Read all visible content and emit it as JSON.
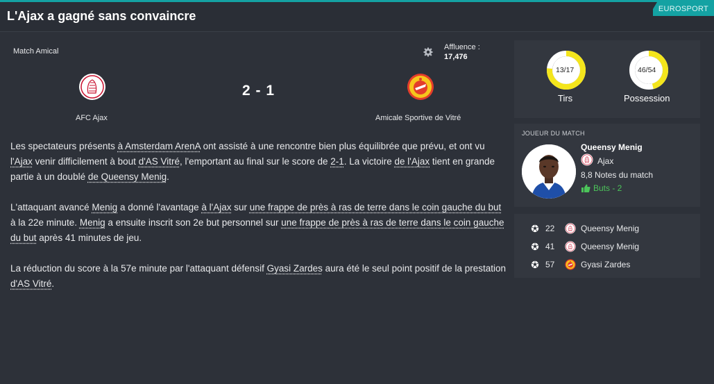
{
  "header": {
    "title": "L'Ajax a gagné sans convaincre",
    "source": "EUROSPORT"
  },
  "match": {
    "competition": "Match Amical",
    "attendance_label": "Affluence :",
    "attendance_value": "17,476",
    "score": "2 - 1",
    "home_team": "AFC Ajax",
    "away_team": "Amicale Sportive de Vitré",
    "icons": [
      "gear-icon",
      "ajax-crest",
      "vitre-crest"
    ]
  },
  "article": {
    "p1": {
      "t1": "Les spectateurs présents ",
      "l1": "à Amsterdam ArenA",
      "t2": " ont assisté à une rencontre bien plus équilibrée que prévu, et ont vu ",
      "l2": "l'Ajax",
      "t3": " venir difficilement à bout ",
      "l3": "d'AS Vitré",
      "t4": ", l'emportant au final sur le score de ",
      "l4": "2-1",
      "t5": ". La victoire ",
      "l5": "de l'Ajax",
      "t6": " tient en grande partie à un doublé ",
      "l6": "de Queensy Menig",
      "t7": "."
    },
    "p2": {
      "t1": "L'attaquant avancé ",
      "l1": "Menig",
      "t2": " a donné l'avantage ",
      "l2": "à l'Ajax",
      "t3": " sur ",
      "l3": "une frappe de près à ras de terre dans le coin gauche du but",
      "t4": " à la 22e minute. ",
      "l4": "Menig",
      "t5": " a ensuite inscrit son 2e but personnel sur ",
      "l5": "une frappe de près à ras de terre dans le coin gauche du but",
      "t6": " après 41 minutes de jeu."
    },
    "p3": {
      "t1": "La réduction du score à la 57e minute par l'attaquant défensif ",
      "l1": "Gyasi Zardes",
      "t2": " aura été le seul point positif de la prestation ",
      "l2": "d'AS Vitré",
      "t3": "."
    }
  },
  "stats": [
    {
      "label": "Tirs",
      "value": "13/17",
      "fraction": 0.7647
    },
    {
      "label": "Possession",
      "value": "46/54",
      "fraction": 0.46
    }
  ],
  "stats_colors": {
    "ring": "#f4e51c",
    "ring_bg": "#ffffff"
  },
  "potm": {
    "heading": "JOUEUR DU MATCH",
    "name": "Queensy Menig",
    "club": "Ajax",
    "rating": "8,8 Notes du match",
    "goals": "Buts - 2"
  },
  "goals": [
    {
      "minute": "22",
      "scorer": "Queensy Menig",
      "team": "ajax"
    },
    {
      "minute": "41",
      "scorer": "Queensy Menig",
      "team": "ajax"
    },
    {
      "minute": "57",
      "scorer": "Gyasi Zardes",
      "team": "vitre"
    }
  ],
  "colors": {
    "accent": "#14a2a3",
    "positive": "#4cc45a",
    "background": "#2d3139"
  }
}
